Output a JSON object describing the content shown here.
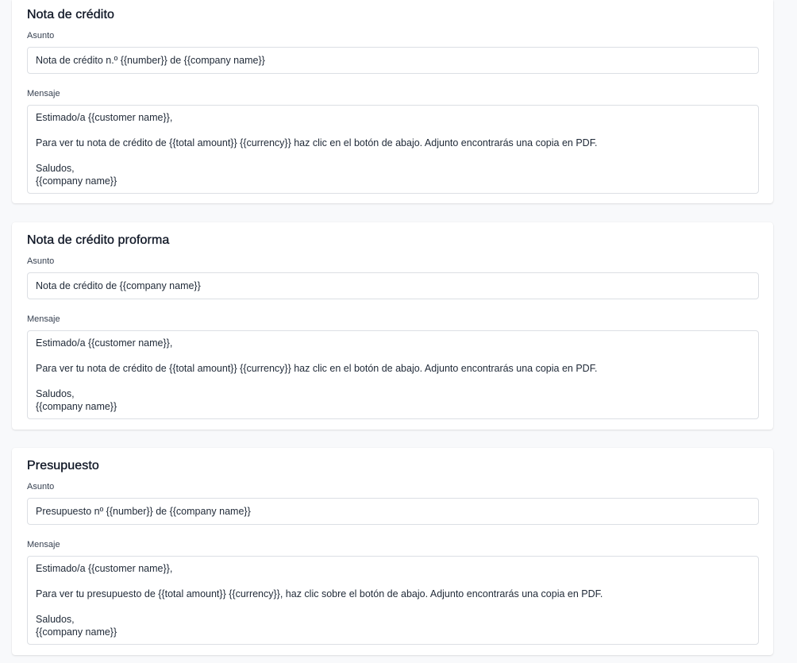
{
  "sections": [
    {
      "title": "Nota de crédito",
      "subject_label": "Asunto",
      "subject_value": "Nota de crédito n.º {{number}} de {{company name}}",
      "message_label": "Mensaje",
      "message_lines": [
        "Estimado/a {{customer name}},",
        "",
        "Para ver tu nota de crédito de {{total amount}} {{currency}} haz clic en el botón de abajo. Adjunto encontrarás una copia en PDF.",
        "",
        "Saludos,",
        "{{company name}}"
      ]
    },
    {
      "title": "Nota de crédito proforma",
      "subject_label": "Asunto",
      "subject_value": "Nota de crédito de {{company name}}",
      "message_label": "Mensaje",
      "message_lines": [
        "Estimado/a {{customer name}},",
        "",
        "Para ver tu nota de crédito de {{total amount}} {{currency}} haz clic en el botón de abajo. Adjunto encontrarás una copia en PDF.",
        "",
        "Saludos,",
        "{{company name}}"
      ]
    },
    {
      "title": "Presupuesto",
      "subject_label": "Asunto",
      "subject_value": "Presupuesto nº {{number}} de {{company name}}",
      "message_label": "Mensaje",
      "message_lines": [
        "Estimado/a {{customer name}},",
        "",
        "Para ver tu presupuesto de {{total amount}} {{currency}}, haz clic sobre el botón de abajo. Adjunto encontrarás una copia en PDF.",
        "",
        "Saludos,",
        "{{company name}}"
      ]
    }
  ]
}
